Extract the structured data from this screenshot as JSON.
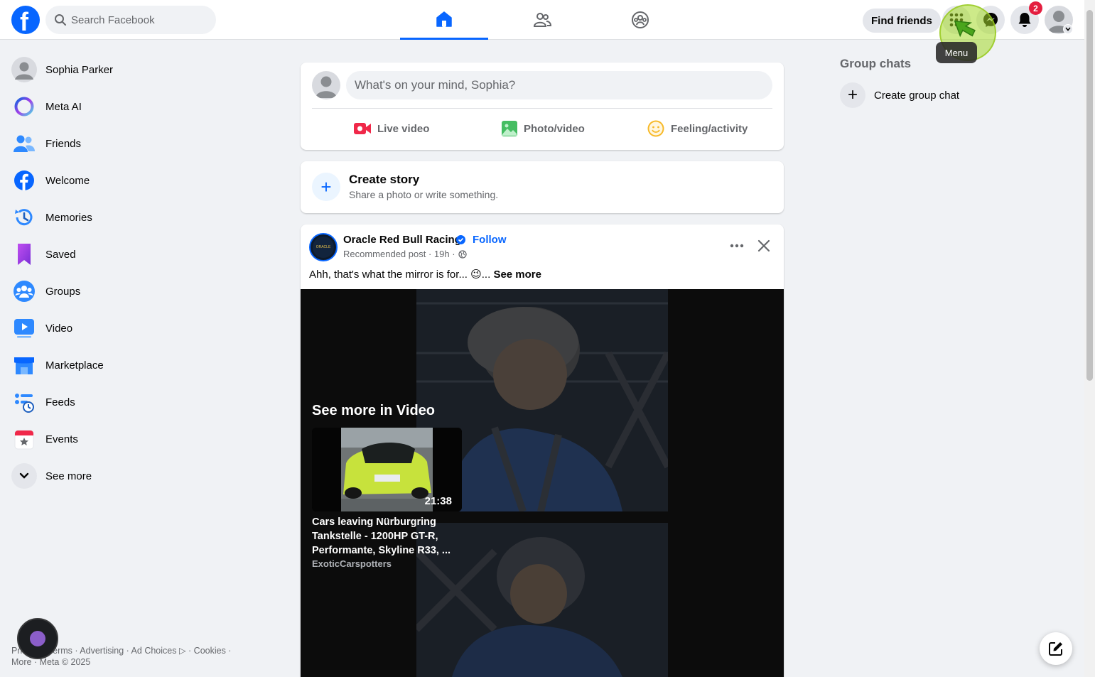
{
  "header": {
    "search": {
      "placeholder": "Search Facebook"
    },
    "find_friends_label": "Find friends",
    "notification_count": "2",
    "menu_tooltip": "Menu",
    "logo_letter": "f"
  },
  "sidebar": {
    "items": [
      {
        "label": "Sophia Parker",
        "icon": "user-avatar-icon"
      },
      {
        "label": "Meta AI",
        "icon": "meta-ai-icon"
      },
      {
        "label": "Friends",
        "icon": "friends-icon"
      },
      {
        "label": "Welcome",
        "icon": "facebook-icon"
      },
      {
        "label": "Memories",
        "icon": "memories-clock-icon"
      },
      {
        "label": "Saved",
        "icon": "bookmark-icon"
      },
      {
        "label": "Groups",
        "icon": "groups-icon"
      },
      {
        "label": "Video",
        "icon": "video-play-icon"
      },
      {
        "label": "Marketplace",
        "icon": "marketplace-shop-icon"
      },
      {
        "label": "Feeds",
        "icon": "feeds-icon"
      },
      {
        "label": "Events",
        "icon": "events-calendar-icon"
      },
      {
        "label": "See more",
        "icon": "chevron-down-icon"
      }
    ],
    "footer_line1": "Privacy · Terms · Advertising · Ad Choices ▷ · Cookies ·",
    "footer_line2": "More · Meta © 2025"
  },
  "composer": {
    "placeholder": "What's on your mind, Sophia?",
    "actions": [
      {
        "label": "Live video",
        "icon": "live-video-icon"
      },
      {
        "label": "Photo/video",
        "icon": "photo-icon"
      },
      {
        "label": "Feeling/activity",
        "icon": "smiley-icon"
      }
    ]
  },
  "story": {
    "title": "Create story",
    "subtitle": "Share a photo or write something."
  },
  "post": {
    "author": "Oracle Red Bull Racing",
    "follow_label": "Follow",
    "meta": "Recommended post · 19h ·",
    "text": "Ahh, that's what the mirror is for... 😉...",
    "see_more": "See more",
    "avatar_text": "ORACLE",
    "video_section": {
      "heading": "See more in Video",
      "duration": "21:38",
      "title": "Cars leaving Nürburgring Tankstelle - 1200HP GT-R, Performante, Skyline R33, ...",
      "channel": "ExoticCarspotters"
    }
  },
  "right_panel": {
    "title": "Group chats",
    "create_label": "Create group chat"
  },
  "colors": {
    "brand_blue": "#0866ff",
    "background": "#f0f2f5",
    "badge_red": "#e41e3f",
    "highlight": "#a4d928"
  }
}
